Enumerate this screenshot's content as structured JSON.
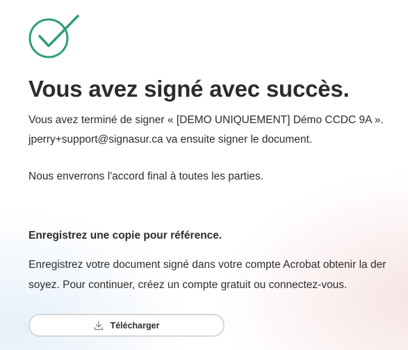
{
  "page": {
    "title": "Vous avez signé avec succès.",
    "completed_text": "Vous avez terminé de signer « [DEMO UNIQUEMENT] Démo CCDC 9A ».",
    "next_signer_text": "jperry+support@signasur.ca va ensuite signer le document.",
    "final_text": "Nous enverrons l'accord final à toutes les parties."
  },
  "save_section": {
    "heading": "Enregistrez une copie pour référence.",
    "body_line1": "Enregistrez votre document signé dans votre compte Acrobat obtenir la der",
    "body_line2": "soyez. Pour continuer, créez un compte gratuit ou connectez-vous.",
    "download_label": "Télécharger"
  },
  "icons": {
    "success": "success-check-icon",
    "download": "download-icon"
  },
  "colors": {
    "success_green": "#2d9d78",
    "text": "#2c2c2c",
    "button_border": "#d6d6d6"
  }
}
